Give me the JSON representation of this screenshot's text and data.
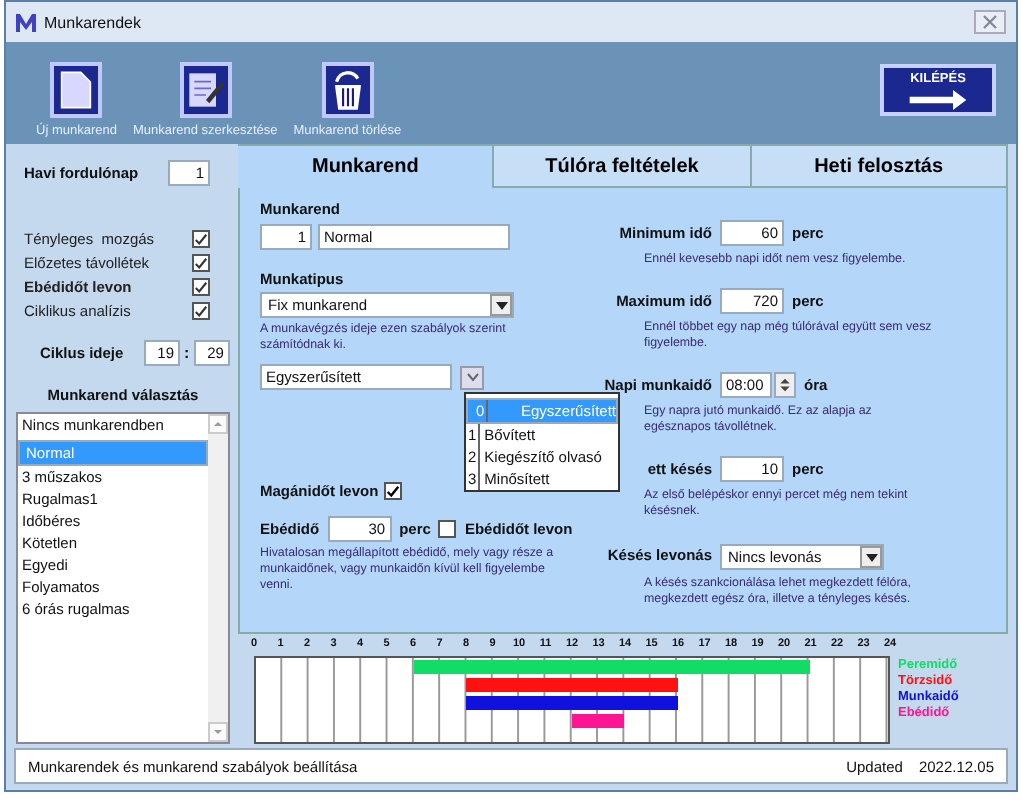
{
  "window": {
    "title": "Munkarendek"
  },
  "toolbar": [
    {
      "label": "Új munkarend",
      "kind": "new"
    },
    {
      "label": "Munkarend szerkesztése",
      "kind": "edit"
    },
    {
      "label": "Munkarend törlése",
      "kind": "delete"
    }
  ],
  "exit_button": {
    "label": "KILÉPÉS"
  },
  "left": {
    "monthly_day": {
      "label": "Havi fordulónap",
      "value": "1"
    },
    "checks": [
      {
        "label": "Tényleges  mozgás",
        "checked": true,
        "bold": false
      },
      {
        "label": "Előzetes távollétek",
        "checked": true,
        "bold": false
      },
      {
        "label": "Ebédidőt levon",
        "checked": true,
        "bold": true
      },
      {
        "label": "Ciklikus analízis",
        "checked": true,
        "bold": false
      }
    ],
    "cycle": {
      "label": "Ciklus ideje",
      "hours": "19",
      "sep": ":",
      "minutes": "29"
    },
    "list_title": "Munkarend választás",
    "list": [
      {
        "label": "Nincs munkarendben",
        "selected": false
      },
      {
        "label": "Normal",
        "selected": true
      },
      {
        "label": "3 műszakos",
        "selected": false
      },
      {
        "label": "Rugalmas1",
        "selected": false
      },
      {
        "label": "Időbéres",
        "selected": false
      },
      {
        "label": "Kötetlen",
        "selected": false
      },
      {
        "label": "Egyedi",
        "selected": false
      },
      {
        "label": "Folyamatos",
        "selected": false
      },
      {
        "label": "6 órás rugalmas",
        "selected": false
      }
    ]
  },
  "tabs": [
    {
      "label": "Munkarend",
      "selected": true
    },
    {
      "label": "Túlóra feltételek",
      "selected": false
    },
    {
      "label": "Heti felosztás",
      "selected": false
    }
  ],
  "form": {
    "munkarend_label": "Munkarend",
    "munkarend_no": "1",
    "munkarend_name": "Normal",
    "type_label": "Munkatipus",
    "type_value": "Fix munkarend",
    "type_desc": "A munkavégzés ideje ezen szabályok szerint számítódnak ki.",
    "mode_value": "Egyszerűsített",
    "mode_options": [
      {
        "index": "0",
        "label": "Egyszerűsített",
        "selected": true
      },
      {
        "index": "1",
        "label": "Bővített",
        "selected": false
      },
      {
        "index": "2",
        "label": "Kiegészítő olvasó",
        "selected": false
      },
      {
        "index": "3",
        "label": "Minősített",
        "selected": false
      }
    ],
    "private_label": "Magánidőt levon",
    "private_checked": true,
    "lunch_label": "Ebédidő",
    "lunch_value": "30",
    "lunch_unit": "perc",
    "lunch_check_label": "Ebédidőt levon",
    "lunch_checked": false,
    "lunch_desc": "Hivatalosan megállapított ebédidő, mely vagy része a munkaidőnek, vagy munkaidőn kívül kell figyelembe venni.",
    "right": [
      {
        "label": "Minimum idő",
        "value": "60",
        "unit": "perc",
        "kind": "number",
        "desc": "Ennél kevesebb napi időt nem vesz figyelembe."
      },
      {
        "label": "Maximum idő",
        "value": "720",
        "unit": "perc",
        "kind": "number",
        "desc": "Ennél többet egy nap még túlórával együtt sem vesz figyelembe."
      },
      {
        "label": "Napi munkaidő",
        "value": "08:00",
        "unit": "óra",
        "kind": "spin",
        "desc": "Egy napra jutó munkaidő. Ez az alapja az egésznapos távollétnek."
      },
      {
        "label": "ett késés",
        "value": "10",
        "unit": "perc",
        "kind": "number",
        "desc": "Az első belépéskor ennyi percet még nem tekint késésnek."
      },
      {
        "label": "Késés levonás",
        "value": "Nincs levonás",
        "kind": "select",
        "desc": "A késés szankcionálása lehet megkezdett félóra, megkezdett egész óra, illetve a tényleges késés."
      }
    ]
  },
  "timeline": {
    "hours": [
      "0",
      "1",
      "2",
      "3",
      "4",
      "5",
      "6",
      "7",
      "8",
      "9",
      "10",
      "11",
      "12",
      "13",
      "14",
      "15",
      "16",
      "17",
      "18",
      "19",
      "20",
      "21",
      "22",
      "23",
      "24"
    ],
    "bands": [
      {
        "label": "Peremidő",
        "color": "#11dd66",
        "cells": [
          false,
          false,
          false,
          false,
          false,
          false,
          true,
          true,
          true,
          true,
          true,
          true,
          true,
          true,
          true,
          true,
          true,
          true,
          true,
          true,
          true,
          false,
          false,
          false
        ]
      },
      {
        "label": "Törzsidő",
        "color": "#ff1111",
        "cells": [
          false,
          false,
          false,
          false,
          false,
          false,
          false,
          false,
          true,
          true,
          true,
          true,
          true,
          true,
          true,
          true,
          false,
          false,
          false,
          false,
          false,
          false,
          false,
          false
        ]
      },
      {
        "label": "Munkaidő",
        "color": "#1111dd",
        "cells": [
          false,
          false,
          false,
          false,
          false,
          false,
          false,
          false,
          true,
          true,
          true,
          true,
          true,
          true,
          true,
          true,
          false,
          false,
          false,
          false,
          false,
          false,
          false,
          false
        ]
      },
      {
        "label": "Ebédidő",
        "color": "#ff1493",
        "cells": [
          false,
          false,
          false,
          false,
          false,
          false,
          false,
          false,
          false,
          false,
          false,
          false,
          true,
          true,
          false,
          false,
          false,
          false,
          false,
          false,
          false,
          false,
          false,
          false
        ]
      }
    ]
  },
  "status_bar": {
    "text": "Munkarendek és munkarend szabályok beállítása",
    "updated_label": "Updated",
    "updated_value": "2022.12.05"
  }
}
